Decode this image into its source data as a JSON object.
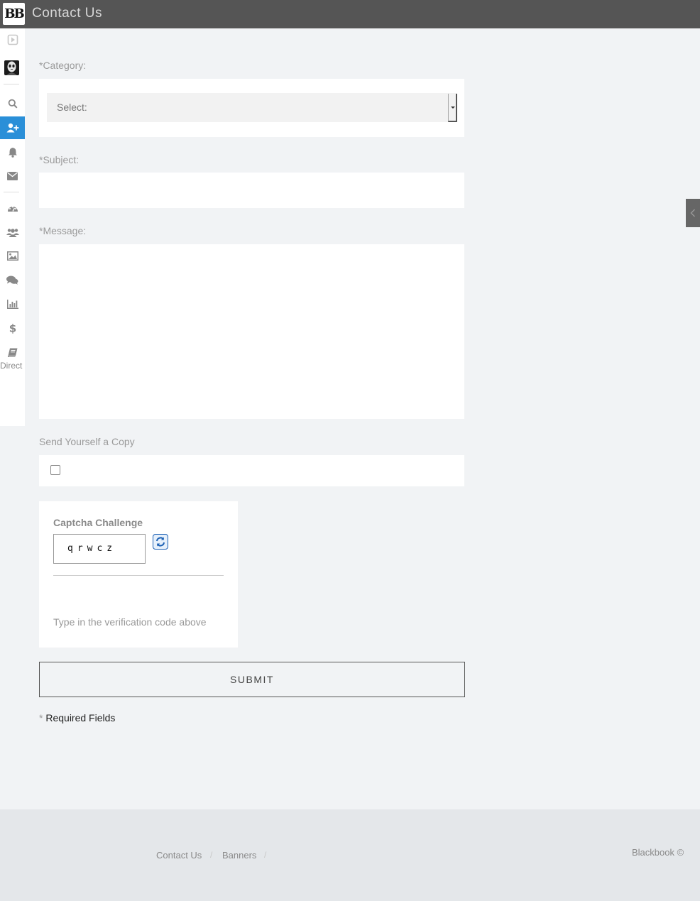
{
  "header": {
    "logo_text": "BB",
    "title": "Contact Us"
  },
  "sidebar": {
    "items": [
      {
        "icon": "play-icon"
      },
      {
        "icon": "avatar"
      },
      {
        "icon": "search-icon"
      },
      {
        "icon": "add-user-icon",
        "active": true
      },
      {
        "icon": "bell-icon"
      },
      {
        "icon": "envelope-icon"
      },
      {
        "icon": "dashboard-icon"
      },
      {
        "icon": "users-icon"
      },
      {
        "icon": "image-icon"
      },
      {
        "icon": "comments-icon"
      },
      {
        "icon": "bar-chart-icon"
      },
      {
        "icon": "dollar-icon"
      },
      {
        "icon": "book-icon"
      }
    ],
    "directory_label": "Direct",
    "active_color": "#2a8fd8"
  },
  "form": {
    "category_label": "*Category:",
    "category_placeholder": "Select:",
    "subject_label": "*Subject:",
    "subject_value": "",
    "message_label": "*Message:",
    "message_value": "",
    "copy_label": "Send Yourself a Copy",
    "copy_checked": false,
    "captcha_title": "Captcha Challenge",
    "captcha_code": "qrwcz",
    "captcha_hint": "Type in the verification code above",
    "submit_label": "SUBMIT",
    "required_star": "*",
    "required_text": "Required Fields"
  },
  "footer": {
    "links": [
      "Contact Us",
      "Banners"
    ],
    "separator": "/",
    "copyright": "Blackbook ©"
  }
}
